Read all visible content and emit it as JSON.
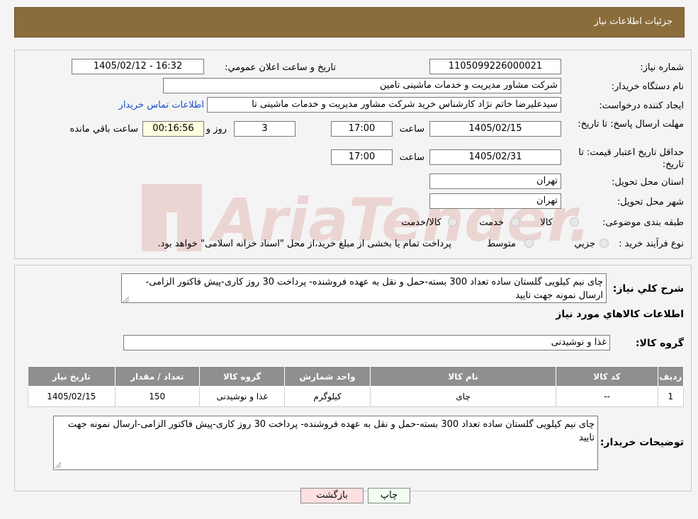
{
  "header": {
    "title": "جزئیات اطلاعات نیاز"
  },
  "watermark": {
    "text": "AriaTender.neT",
    "color": "#c0392b"
  },
  "form": {
    "need_number_label": "شماره نياز:",
    "need_number": "1105099226000021",
    "announce_label": "تاريخ و ساعت اعلان عمومي:",
    "announce_value": "1405/02/12 - 16:32",
    "buyer_org_label": "نام دستگاه خريدار:",
    "buyer_org": "شرکت مشاور مدیریت و خدمات ماشینی تامین",
    "creator_label": "ايجاد کننده درخواست:",
    "creator": "سیدعلیرضا خاتم نژاد کارشناس خرید شرکت مشاور مدیریت و خدمات ماشینی تا",
    "contact_link": "اطلاعات تماس خريدار",
    "deadline_label": "مهلت ارسال پاسخ: تا تاريخ:",
    "deadline_date": "1405/02/15",
    "time_label": "ساعت",
    "deadline_time": "17:00",
    "days_value": "3",
    "days_label": "روز و",
    "remaining_value": "00:16:56",
    "remaining_label": "ساعت باقي مانده",
    "validity_label": "حداقل تاريخ اعتبار قيمت: تا تاريخ:",
    "validity_date": "1405/02/31",
    "validity_time": "17:00",
    "province_label": "استان محل تحويل:",
    "province": "تهران",
    "city_label": "شهر محل تحويل:",
    "city": "تهران",
    "category_label": "طبقه بندی موضوعی:",
    "category_options": [
      "کالا",
      "خدمت",
      "کالا/خدمت"
    ],
    "process_label": "نوع فرآيند خريد :",
    "process_options": [
      "جزيي",
      "متوسط"
    ],
    "process_note": "پرداخت تمام يا بخشی از مبلغ خريد،از محل \"اسناد خزانه اسلامی\" خواهد بود."
  },
  "summary": {
    "label": "شرح کلي نياز:",
    "text": "چای نیم کیلویی گلستان ساده تعداد 300 بسته-حمل و نقل به عهده فروشنده- پرداخت 30 روز کاری-پیش فاکتور الزامی-ارسال نمونه جهت تایید",
    "goods_info_title": "اطلاعات کالاهاي مورد نياز",
    "goods_group_label": "گروه کالا:",
    "goods_group": "غذا و نوشیدنی"
  },
  "table": {
    "headers": [
      "رديف",
      "کد کالا",
      "نام کالا",
      "واحد شمارش",
      "گروه کالا",
      "تعداد / مقدار",
      "تاريخ نياز"
    ],
    "rows": [
      [
        "1",
        "--",
        "چای",
        "کیلوگرم",
        "غذا و نوشیدنی",
        "150",
        "1405/02/15"
      ]
    ]
  },
  "buyer_notes": {
    "label": "توضيحات خريدار:",
    "text": "چای نیم کیلویی گلستان ساده تعداد 300 بسته-حمل و نقل به عهده فروشنده- پرداخت 30 روز کاری-پیش فاکتور الزامی-ارسال نمونه جهت تایید"
  },
  "buttons": {
    "print": "چاپ",
    "back": "بازگشت"
  }
}
